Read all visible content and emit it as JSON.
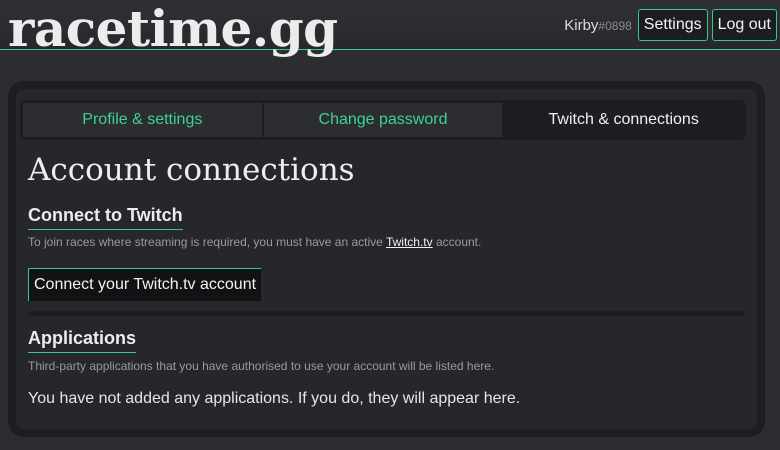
{
  "header": {
    "logo": "racetime.gg",
    "user": {
      "name": "Kirby",
      "discriminator": "#0898"
    },
    "settings_label": "Settings",
    "logout_label": "Log out"
  },
  "tabs": [
    {
      "label": "Profile & settings",
      "active": false
    },
    {
      "label": "Change password",
      "active": false
    },
    {
      "label": "Twitch & connections",
      "active": true
    }
  ],
  "page": {
    "title": "Account connections",
    "twitch": {
      "heading": "Connect to Twitch",
      "desc_before": "To join races where streaming is required, you must have an active ",
      "desc_link": "Twitch.tv",
      "desc_after": " account.",
      "button_label": "Connect your Twitch.tv account"
    },
    "applications": {
      "heading": "Applications",
      "desc": "Third-party applications that you have authorised to use your account will be listed here.",
      "empty_message": "You have not added any applications. If you do, they will appear here."
    }
  },
  "colors": {
    "accent": "#3cc68a",
    "background": "#2b2d31",
    "panel": "#25272b"
  }
}
